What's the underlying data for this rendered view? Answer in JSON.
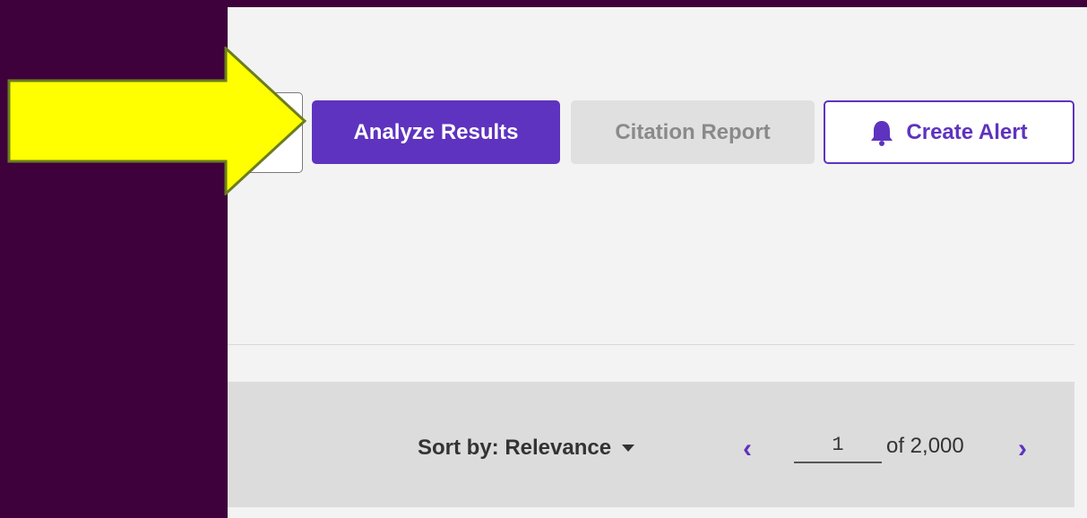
{
  "toolbar": {
    "analyze_label": "Analyze Results",
    "citation_label": "Citation Report",
    "alert_label": "Create Alert",
    "alert_icon": "bell-icon"
  },
  "results_bar": {
    "sort_label": "Sort by: Relevance",
    "prev_icon": "chevron-left-icon",
    "page_value": "1",
    "page_total": "of 2,000",
    "next_icon": "chevron-right-icon"
  },
  "colors": {
    "accent": "#5e33bf",
    "background": "#3e013c",
    "highlight_arrow": "#ffff00"
  }
}
